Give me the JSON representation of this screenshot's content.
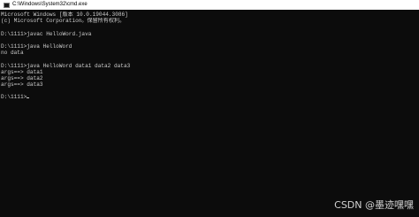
{
  "window": {
    "title": "C:\\Windows\\System32\\cmd.exe",
    "icon": "cmd-icon"
  },
  "console": {
    "lines": [
      "Microsoft Windows [版本 10.0.19044.3086]",
      "(c) Microsoft Corporation。保留所有权利。",
      "",
      "D:\\1111>javac HelloWord.java",
      "",
      "D:\\1111>java HelloWord",
      "no data",
      "",
      "D:\\1111>java HelloWord data1 data2 data3",
      "args==> data1",
      "args==> data2",
      "args==> data3",
      "",
      "D:\\1111>"
    ]
  },
  "watermark": "CSDN @墨迹嘿嘿",
  "colors": {
    "background": "#0c0c0c",
    "text": "#cccccc",
    "titlebar": "#ffffff"
  }
}
